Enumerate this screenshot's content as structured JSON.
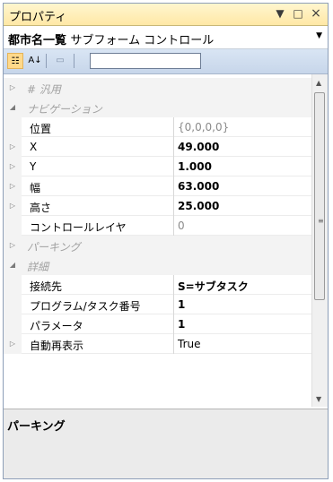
{
  "window": {
    "title": "プロパティ",
    "controls": {
      "dropdown_icon": "▼",
      "maximize_icon": "□",
      "close_icon": "×"
    }
  },
  "object_selector": {
    "name": "都市名一覧",
    "type": "サブフォーム コントロール",
    "arrow": "▼"
  },
  "toolbar": {
    "categorized_icon": "☷",
    "alphabetical_icon": "A↓",
    "property_pages_icon": "▭",
    "search_value": ""
  },
  "grid": {
    "rows": [
      {
        "kind": "category",
        "expander": "▷",
        "name": "# 汎用"
      },
      {
        "kind": "category",
        "expander": "◢",
        "name": "ナビゲーション"
      },
      {
        "kind": "property",
        "expander": "",
        "name": "位置",
        "value": "{0,0,0,0}"
      },
      {
        "kind": "property",
        "expander": "▷",
        "name": "X",
        "value": "49.000"
      },
      {
        "kind": "property",
        "expander": "▷",
        "name": "Y",
        "value": "1.000"
      },
      {
        "kind": "property",
        "expander": "▷",
        "name": "幅",
        "value": "63.000"
      },
      {
        "kind": "property",
        "expander": "▷",
        "name": "高さ",
        "value": "25.000"
      },
      {
        "kind": "property",
        "expander": "",
        "name": "コントロールレイヤ",
        "value": "0"
      },
      {
        "kind": "category",
        "expander": "▷",
        "name": "パーキング"
      },
      {
        "kind": "category",
        "expander": "◢",
        "name": "詳細"
      },
      {
        "kind": "property",
        "expander": "",
        "name": "接続先",
        "value": "S=サブタスク"
      },
      {
        "kind": "property",
        "expander": "",
        "name": "プログラム/タスク番号",
        "value": "1"
      },
      {
        "kind": "property",
        "expander": "",
        "name": "パラメータ",
        "value": "1"
      },
      {
        "kind": "property",
        "expander": "▷",
        "name": "自動再表示",
        "value": "True"
      }
    ]
  },
  "scrollbar": {
    "up_icon": "▲",
    "down_icon": "▼",
    "grip": "≡"
  },
  "description": {
    "title": "パーキング"
  }
}
